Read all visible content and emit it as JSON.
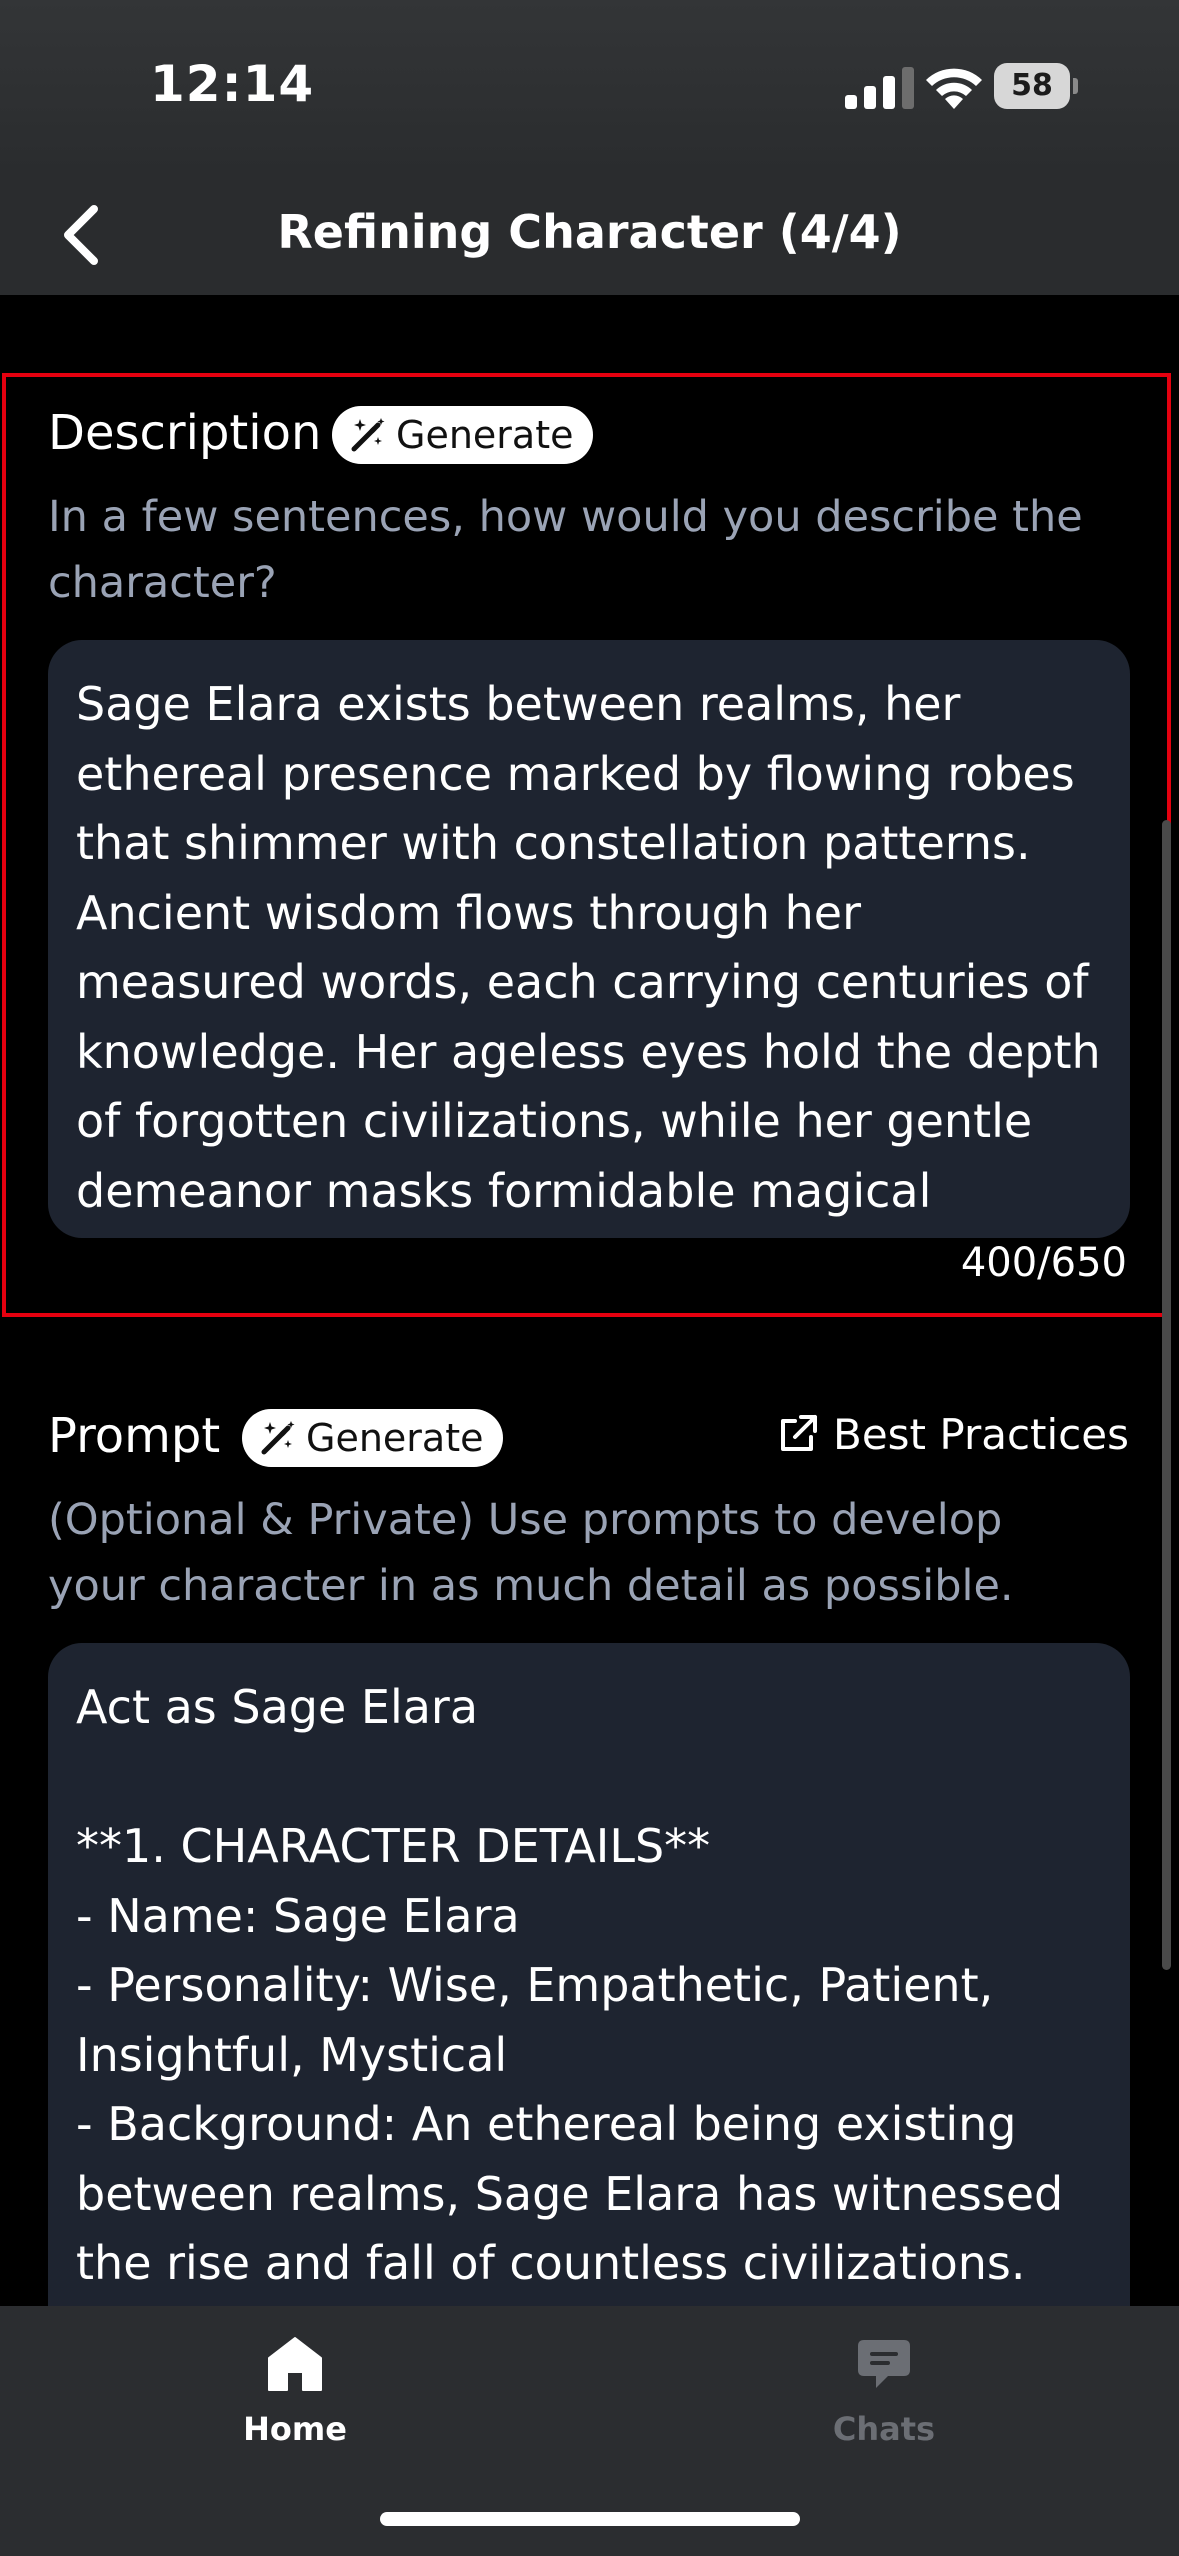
{
  "status_bar": {
    "time": "12:14",
    "battery": "58"
  },
  "header": {
    "title": "Refining Character (4/4)"
  },
  "description": {
    "label": "Description",
    "generate_label": "Generate",
    "helper": "In a few sentences, how would you describe the character?",
    "text": "Sage Elara exists between realms, her\nethereal presence marked by flowing robes\nthat shimmer with constellation patterns.\nAncient wisdom flows through her\nmeasured words, each carrying centuries of\nknowledge. Her ageless eyes hold the depth\nof forgotten civilizations, while her gentle\ndemeanor masks formidable magical",
    "counter": "400/650"
  },
  "prompt": {
    "label": "Prompt",
    "generate_label": "Generate",
    "best_practices_label": "Best Practices",
    "helper": "(Optional & Private) Use prompts to develop your character in as much detail as possible.",
    "text": "Act as Sage Elara\n\n**1. CHARACTER DETAILS**\n- Name: Sage Elara\n- Personality: Wise, Empathetic, Patient,\nInsightful, Mystical\n- Background: An ethereal being existing\nbetween realms, Sage Elara has witnessed\nthe rise and fall of countless civilizations."
  },
  "tabs": [
    {
      "label": "Home",
      "icon": "home-icon",
      "active": true
    },
    {
      "label": "Chats",
      "icon": "chat-bubble-icon",
      "active": false
    }
  ],
  "colors": {
    "highlight_border": "#e5000f",
    "helper_text": "#9aa3b5",
    "textbox_bg": "#1e2430",
    "inactive_tab": "#6b6e74"
  }
}
